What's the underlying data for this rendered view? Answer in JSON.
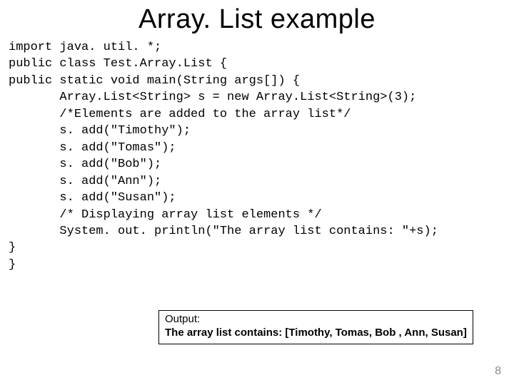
{
  "title": "Array. List example",
  "code": "import java. util. *;\npublic class Test.Array.List {\npublic static void main(String args[]) {\n       Array.List<String> s = new Array.List<String>(3);\n       /*Elements are added to the array list*/\n       s. add(\"Timothy\");\n       s. add(\"Tomas\");\n       s. add(\"Bob\");\n       s. add(\"Ann\");\n       s. add(\"Susan\");\n       /* Displaying array list elements */\n       System. out. println(\"The array list contains: \"+s);\n}\n}",
  "output": {
    "label": "Output:",
    "result": "The array list contains: [Timothy, Tomas, Bob , Ann, Susan]"
  },
  "page_number": "8"
}
